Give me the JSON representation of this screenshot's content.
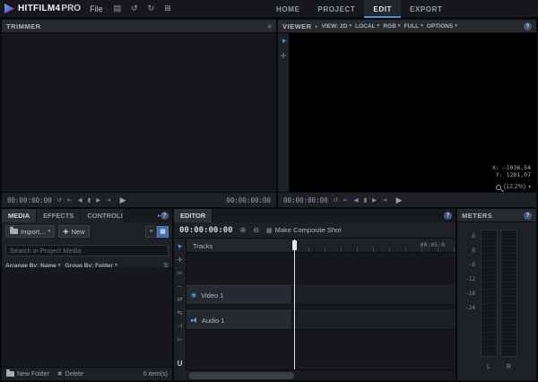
{
  "topbar": {
    "logo_main": "HITFILM4",
    "logo_sub": "PRO",
    "file_menu": "File",
    "tabs": [
      {
        "label": "HOME"
      },
      {
        "label": "PROJECT"
      },
      {
        "label": "EDIT"
      },
      {
        "label": "EXPORT"
      }
    ]
  },
  "icons": {
    "save": "▤",
    "undo": "↺",
    "redo": "↻",
    "layout": "⊞",
    "panel_menu": "≡",
    "caret": "▾",
    "chevron": "▸",
    "help": "?",
    "loop": "↺",
    "goto_start": "⇤",
    "step_back": "◀",
    "stop": "▮",
    "step_fwd": "▶",
    "goto_end": "⇥",
    "play": "▶",
    "select": "➤",
    "hand": "✛",
    "slice": "✂",
    "stretch": "↔",
    "slip": "⇄",
    "slide": "⇆",
    "ripple": "⊣",
    "roll": "⊢",
    "snap": "U",
    "list_view": "≡",
    "grid_view": "▦",
    "sort": "⇅",
    "plus": "✚",
    "trash": "✖",
    "zoom_in": "⊕",
    "zoom_out": "⊖",
    "slate": "▦",
    "eye": "◉"
  },
  "trimmer": {
    "title": "TRIMMER",
    "tc_left": "00:00:00:00",
    "tc_right": "00:00:00:00"
  },
  "viewer": {
    "title": "VIEWER",
    "dropdowns": {
      "view": "VIEW: 2D",
      "local": "LOCAL",
      "rgb": "RGB",
      "full": "FULL",
      "options": "OPTIONS"
    },
    "coord_x": "X: -1036,54",
    "coord_y": "Y: 1201,07",
    "zoom": "(12,2%)",
    "tc": "00:00:00:00"
  },
  "media": {
    "tabs": [
      {
        "label": "MEDIA"
      },
      {
        "label": "EFFECTS"
      },
      {
        "label": "CONTROLS"
      }
    ],
    "import_label": "Import...",
    "new_label": "New",
    "search_placeholder": "Search in Project Media",
    "arrange_label": "Arrange By: Name",
    "group_label": "Group By: Folder",
    "new_folder_label": "New Folder",
    "delete_label": "Delete",
    "item_count": "0 item(s)"
  },
  "editor": {
    "title": "EDITOR",
    "tc": "00:00:00:00",
    "composite_label": "Make Composite Shot",
    "tracks_label": "Tracks",
    "ruler_label": "00:05:0",
    "tracks": [
      {
        "name": "Video 1"
      },
      {
        "name": "Audio 1"
      }
    ]
  },
  "meters": {
    "title": "METERS",
    "scale": [
      "6",
      "0",
      "-6",
      "-12",
      "-18",
      "-24"
    ],
    "channels": [
      "L",
      "R"
    ]
  }
}
